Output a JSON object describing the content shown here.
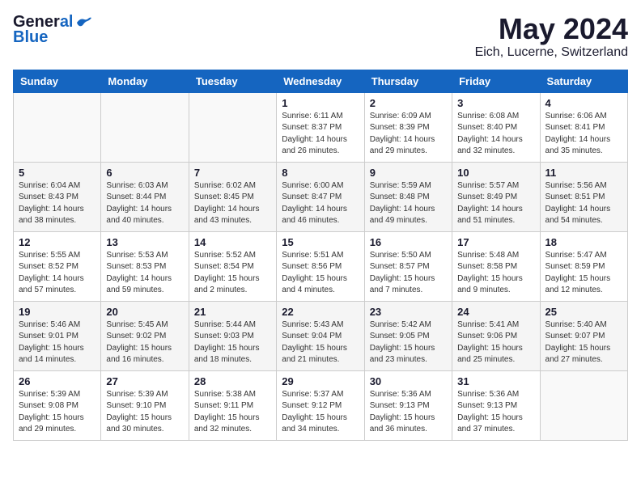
{
  "logo": {
    "general": "General",
    "blue": "Blue"
  },
  "title": "May 2024",
  "location": "Eich, Lucerne, Switzerland",
  "days_of_week": [
    "Sunday",
    "Monday",
    "Tuesday",
    "Wednesday",
    "Thursday",
    "Friday",
    "Saturday"
  ],
  "weeks": [
    [
      {
        "day": "",
        "info": ""
      },
      {
        "day": "",
        "info": ""
      },
      {
        "day": "",
        "info": ""
      },
      {
        "day": "1",
        "info": "Sunrise: 6:11 AM\nSunset: 8:37 PM\nDaylight: 14 hours\nand 26 minutes."
      },
      {
        "day": "2",
        "info": "Sunrise: 6:09 AM\nSunset: 8:39 PM\nDaylight: 14 hours\nand 29 minutes."
      },
      {
        "day": "3",
        "info": "Sunrise: 6:08 AM\nSunset: 8:40 PM\nDaylight: 14 hours\nand 32 minutes."
      },
      {
        "day": "4",
        "info": "Sunrise: 6:06 AM\nSunset: 8:41 PM\nDaylight: 14 hours\nand 35 minutes."
      }
    ],
    [
      {
        "day": "5",
        "info": "Sunrise: 6:04 AM\nSunset: 8:43 PM\nDaylight: 14 hours\nand 38 minutes."
      },
      {
        "day": "6",
        "info": "Sunrise: 6:03 AM\nSunset: 8:44 PM\nDaylight: 14 hours\nand 40 minutes."
      },
      {
        "day": "7",
        "info": "Sunrise: 6:02 AM\nSunset: 8:45 PM\nDaylight: 14 hours\nand 43 minutes."
      },
      {
        "day": "8",
        "info": "Sunrise: 6:00 AM\nSunset: 8:47 PM\nDaylight: 14 hours\nand 46 minutes."
      },
      {
        "day": "9",
        "info": "Sunrise: 5:59 AM\nSunset: 8:48 PM\nDaylight: 14 hours\nand 49 minutes."
      },
      {
        "day": "10",
        "info": "Sunrise: 5:57 AM\nSunset: 8:49 PM\nDaylight: 14 hours\nand 51 minutes."
      },
      {
        "day": "11",
        "info": "Sunrise: 5:56 AM\nSunset: 8:51 PM\nDaylight: 14 hours\nand 54 minutes."
      }
    ],
    [
      {
        "day": "12",
        "info": "Sunrise: 5:55 AM\nSunset: 8:52 PM\nDaylight: 14 hours\nand 57 minutes."
      },
      {
        "day": "13",
        "info": "Sunrise: 5:53 AM\nSunset: 8:53 PM\nDaylight: 14 hours\nand 59 minutes."
      },
      {
        "day": "14",
        "info": "Sunrise: 5:52 AM\nSunset: 8:54 PM\nDaylight: 15 hours\nand 2 minutes."
      },
      {
        "day": "15",
        "info": "Sunrise: 5:51 AM\nSunset: 8:56 PM\nDaylight: 15 hours\nand 4 minutes."
      },
      {
        "day": "16",
        "info": "Sunrise: 5:50 AM\nSunset: 8:57 PM\nDaylight: 15 hours\nand 7 minutes."
      },
      {
        "day": "17",
        "info": "Sunrise: 5:48 AM\nSunset: 8:58 PM\nDaylight: 15 hours\nand 9 minutes."
      },
      {
        "day": "18",
        "info": "Sunrise: 5:47 AM\nSunset: 8:59 PM\nDaylight: 15 hours\nand 12 minutes."
      }
    ],
    [
      {
        "day": "19",
        "info": "Sunrise: 5:46 AM\nSunset: 9:01 PM\nDaylight: 15 hours\nand 14 minutes."
      },
      {
        "day": "20",
        "info": "Sunrise: 5:45 AM\nSunset: 9:02 PM\nDaylight: 15 hours\nand 16 minutes."
      },
      {
        "day": "21",
        "info": "Sunrise: 5:44 AM\nSunset: 9:03 PM\nDaylight: 15 hours\nand 18 minutes."
      },
      {
        "day": "22",
        "info": "Sunrise: 5:43 AM\nSunset: 9:04 PM\nDaylight: 15 hours\nand 21 minutes."
      },
      {
        "day": "23",
        "info": "Sunrise: 5:42 AM\nSunset: 9:05 PM\nDaylight: 15 hours\nand 23 minutes."
      },
      {
        "day": "24",
        "info": "Sunrise: 5:41 AM\nSunset: 9:06 PM\nDaylight: 15 hours\nand 25 minutes."
      },
      {
        "day": "25",
        "info": "Sunrise: 5:40 AM\nSunset: 9:07 PM\nDaylight: 15 hours\nand 27 minutes."
      }
    ],
    [
      {
        "day": "26",
        "info": "Sunrise: 5:39 AM\nSunset: 9:08 PM\nDaylight: 15 hours\nand 29 minutes."
      },
      {
        "day": "27",
        "info": "Sunrise: 5:39 AM\nSunset: 9:10 PM\nDaylight: 15 hours\nand 30 minutes."
      },
      {
        "day": "28",
        "info": "Sunrise: 5:38 AM\nSunset: 9:11 PM\nDaylight: 15 hours\nand 32 minutes."
      },
      {
        "day": "29",
        "info": "Sunrise: 5:37 AM\nSunset: 9:12 PM\nDaylight: 15 hours\nand 34 minutes."
      },
      {
        "day": "30",
        "info": "Sunrise: 5:36 AM\nSunset: 9:13 PM\nDaylight: 15 hours\nand 36 minutes."
      },
      {
        "day": "31",
        "info": "Sunrise: 5:36 AM\nSunset: 9:13 PM\nDaylight: 15 hours\nand 37 minutes."
      },
      {
        "day": "",
        "info": ""
      }
    ]
  ]
}
